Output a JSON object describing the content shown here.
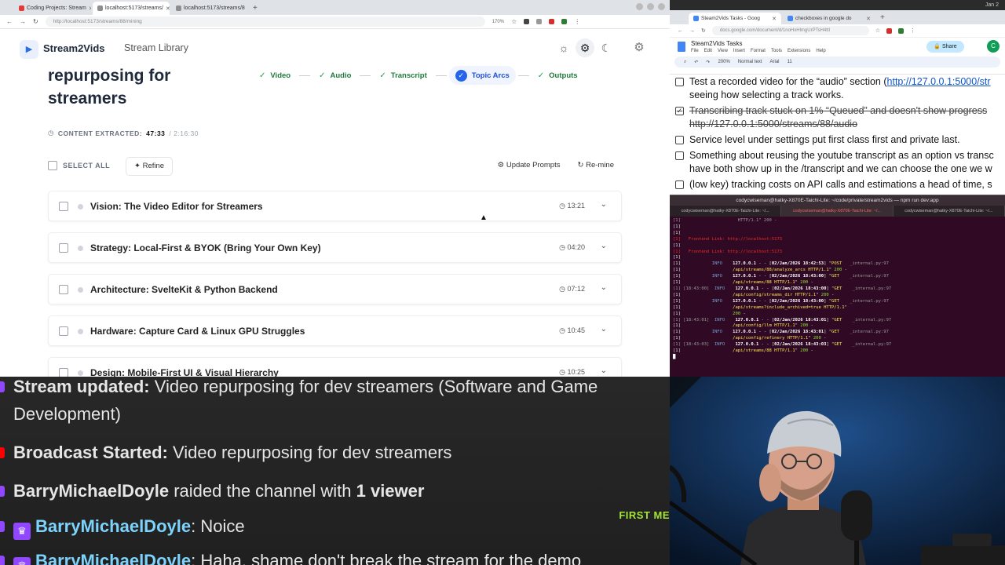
{
  "left_browser": {
    "tabs": [
      {
        "label": "Coding Projects: Stream",
        "color": "#e53935",
        "active": false
      },
      {
        "label": "localhost:5173/streams/",
        "color": "#8e8e8e",
        "active": true
      },
      {
        "label": "localhost:5173/streams/8",
        "color": "#8e8e8e",
        "active": false
      }
    ],
    "url": "http://localhost:5173/streams/88/mining",
    "zoom": "170%"
  },
  "app": {
    "brand": "Stream2Vids",
    "nav_library": "Stream Library",
    "page_title_line1": "repurposing for",
    "page_title_line2": "streamers",
    "steps": [
      {
        "label": "Video",
        "state": "done"
      },
      {
        "label": "Audio",
        "state": "done"
      },
      {
        "label": "Transcript",
        "state": "done"
      },
      {
        "label": "Topic Arcs",
        "state": "active"
      },
      {
        "label": "Outputs",
        "state": "done"
      }
    ],
    "extracted_label": "CONTENT EXTRACTED:",
    "extracted_value": "47:33",
    "extracted_total": "/ 2:16:30",
    "select_all": "SELECT ALL",
    "refine": "Refine",
    "update_prompts": "Update Prompts",
    "remine": "Re-mine",
    "arcs": [
      {
        "title": "Vision: The Video Editor for Streamers",
        "time": "13:21"
      },
      {
        "title": "Strategy: Local-First & BYOK (Bring Your Own Key)",
        "time": "04:20"
      },
      {
        "title": "Architecture: SvelteKit & Python Backend",
        "time": "07:12"
      },
      {
        "title": "Hardware: Capture Card & Linux GPU Struggles",
        "time": "10:45"
      },
      {
        "title": "Design: Mobile-First UI & Visual Hierarchy",
        "time": "10:25"
      }
    ]
  },
  "right_browser": {
    "os_date": "Jan 2",
    "tabs": [
      "Steam2Vids Tasks - Goog",
      "checkboxes in google do"
    ],
    "url": "docs.google.com/document/d/1noHxHlmgUrPTsH4ttl",
    "doc_title": "Steam2Vids Tasks",
    "menu": [
      "File",
      "Edit",
      "View",
      "Insert",
      "Format",
      "Tools",
      "Extensions",
      "Help"
    ],
    "share": "Share",
    "avatar_letter": "C",
    "toolbar": [
      "200%",
      "Normal text",
      "Arial",
      "11"
    ],
    "tasks": [
      {
        "line1": "Test a recorded video for the “audio” section (",
        "link": "http://127.0.0.1:5000/str",
        "line2": "seeing how selecting a track works.",
        "done": false
      },
      {
        "line1": "Transcribing track stuck on 1% “Queued” and doesn't show progress",
        "link": "",
        "line2": "http://127.0.0.1:5000/streams/88/audio",
        "done": true
      },
      {
        "line1": "Service level under settings put first class first and private last.",
        "link": "",
        "line2": "",
        "done": false
      },
      {
        "line1": "Something about reusing the youtube transcript as an option vs transc",
        "link": "",
        "line2": "have both show up in the /transcript and we can choose the one we w",
        "done": false
      },
      {
        "line1": "(low key) tracking costs on API calls and estimations a head of time, s",
        "link": "",
        "line2": "",
        "done": false
      }
    ]
  },
  "terminal": {
    "title": "codycwiseman@hatky-X870E-Taichi-Lite: ~/code/private/stream2vids — npm run dev:app",
    "tabs": [
      "codycwiseman@hatky-X870E-Taichi-Lite: ~/...",
      "codycwiseman@hatky-X870E-Taichi-Lite: ~/...",
      "codycwiseman@hatky-X870E-Taichi-Lite: ~/..."
    ]
  },
  "chat": {
    "messages": [
      {
        "label": "Stream updated:",
        "text": "Video repurposing for dev streamers (Software and Game",
        "text2": "Development)"
      },
      {
        "label": "Broadcast Started:",
        "text": "Video repurposing for dev streamers"
      },
      {
        "user": "BarryMichaelDoyle",
        "text": "raided the channel with",
        "bold_tail": "1 viewer"
      },
      {
        "user": "BarryMichaelDoyle",
        "text": "Noice"
      },
      {
        "user": "BarryMichaelDoyle",
        "text": "Haha, shame don't break the stream for the demo"
      }
    ],
    "first_badge": "FIRST ME",
    "colors": {
      "user": "#7dd3fc",
      "badge": "#a3e635",
      "twitch": "#9146ff",
      "youtube": "#ff0000"
    }
  }
}
